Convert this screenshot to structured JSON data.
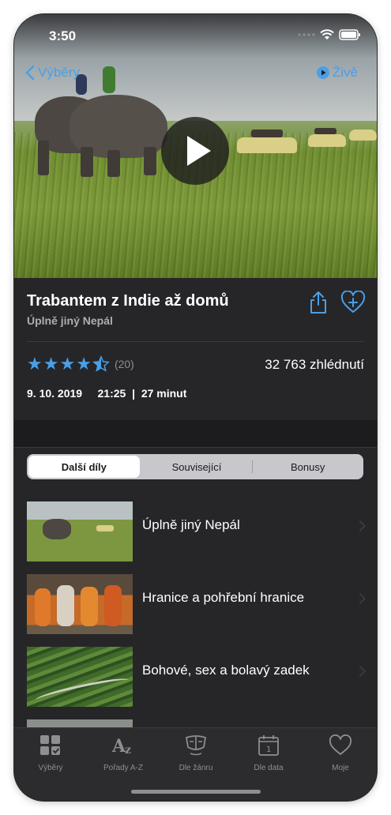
{
  "status": {
    "time": "3:50"
  },
  "nav": {
    "back_label": "Výběry",
    "live_label": "Živě"
  },
  "episode": {
    "title": "Trabantem z Indie až domů",
    "subtitle": "Úplně jiný Nepál",
    "rating_count": "(20)",
    "rating_value": 4.5,
    "views": "32 763 zhlédnutí",
    "date": "9. 10. 2019",
    "time": "21:25",
    "separator": "|",
    "duration": "27 minut"
  },
  "segments": [
    {
      "label": "Další díly",
      "active": true
    },
    {
      "label": "Související",
      "active": false
    },
    {
      "label": "Bonusy",
      "active": false
    }
  ],
  "list": [
    {
      "title": "Úplně jiný Nepál",
      "thumb": "elephants-thumbnail"
    },
    {
      "title": "Hranice a pohřební hranice",
      "thumb": "sadhus-thumbnail"
    },
    {
      "title": "Bohové, sex a bolavý zadek",
      "thumb": "hillside-road-thumbnail"
    }
  ],
  "tabbar": [
    {
      "label": "Výběry",
      "icon": "grid-check-icon"
    },
    {
      "label": "Pořady A-Z",
      "icon": "az-icon"
    },
    {
      "label": "Dle žánru",
      "icon": "theater-masks-icon"
    },
    {
      "label": "Dle data",
      "icon": "calendar-icon"
    },
    {
      "label": "Moje",
      "icon": "heart-icon"
    }
  ],
  "colors": {
    "accent": "#4a9fe6",
    "background": "#1c1c1e",
    "panel": "#262628"
  }
}
